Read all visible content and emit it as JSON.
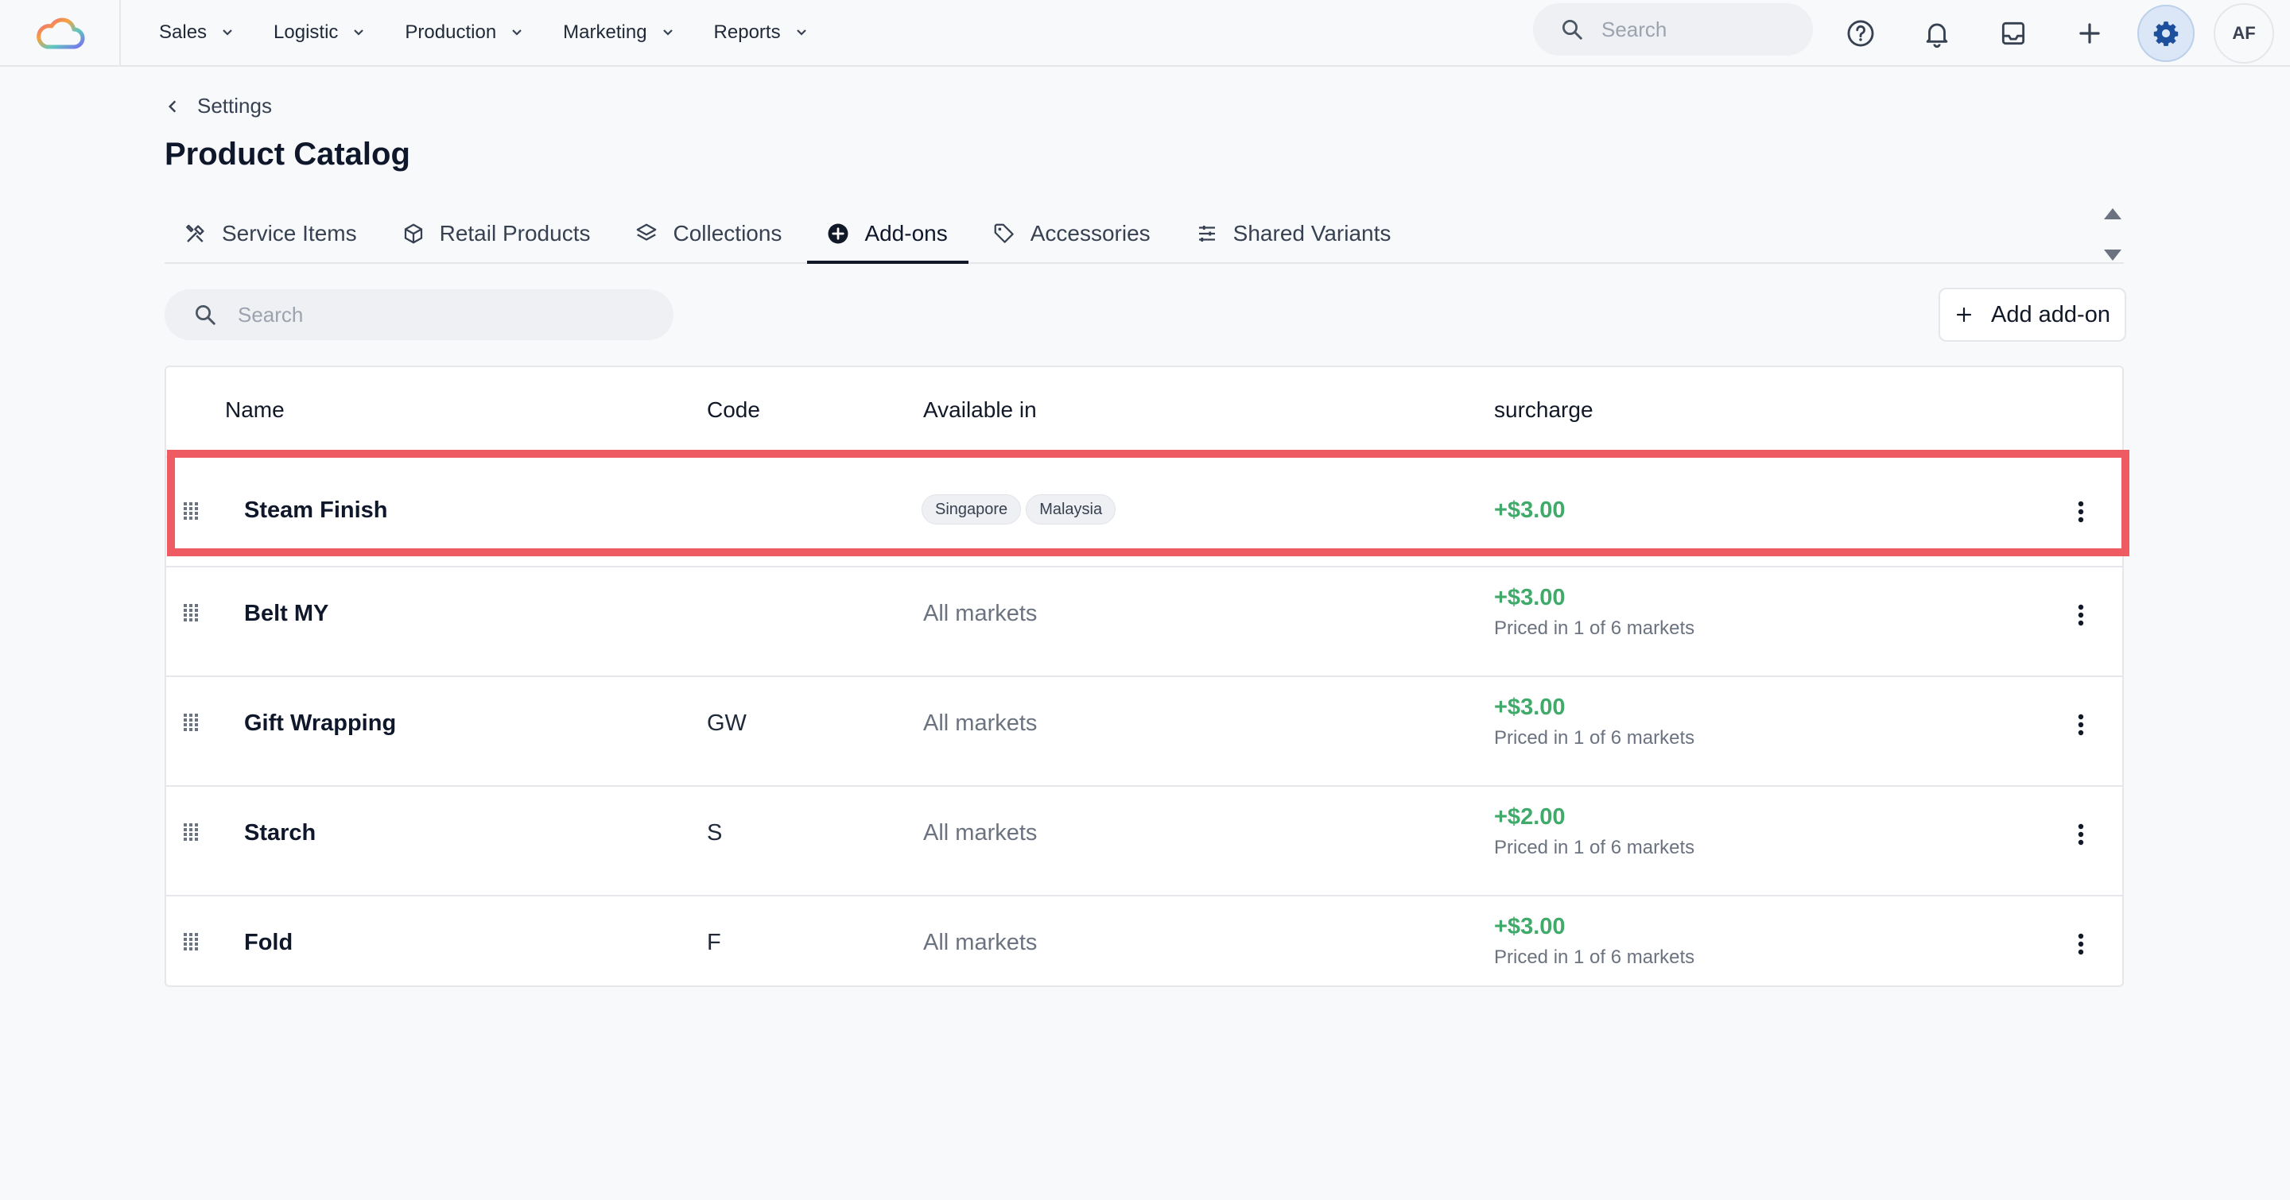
{
  "topbar": {
    "nav": [
      {
        "label": "Sales"
      },
      {
        "label": "Logistic"
      },
      {
        "label": "Production"
      },
      {
        "label": "Marketing"
      },
      {
        "label": "Reports"
      }
    ],
    "search_placeholder": "Search",
    "avatar_initials": "AF"
  },
  "page": {
    "breadcrumb": "Settings",
    "title": "Product Catalog"
  },
  "tabs": [
    {
      "label": "Service Items",
      "icon": "tools-icon"
    },
    {
      "label": "Retail Products",
      "icon": "box-icon"
    },
    {
      "label": "Collections",
      "icon": "layers-icon"
    },
    {
      "label": "Add-ons",
      "icon": "plus-circle-icon",
      "active": true
    },
    {
      "label": "Accessories",
      "icon": "tag-icon"
    },
    {
      "label": "Shared Variants",
      "icon": "sliders-icon"
    }
  ],
  "toolbar": {
    "search_placeholder": "Search",
    "add_label": "Add add-on"
  },
  "table": {
    "headers": {
      "name": "Name",
      "code": "Code",
      "available": "Available in",
      "surcharge": "surcharge"
    },
    "rows": [
      {
        "name": "Steam Finish",
        "code": "",
        "markets": [
          "Singapore",
          "Malaysia"
        ],
        "price": "+$3.00",
        "note": ""
      },
      {
        "name": "Belt MY",
        "code": "",
        "available": "All markets",
        "price": "+$3.00",
        "note": "Priced in 1 of 6 markets"
      },
      {
        "name": "Gift Wrapping",
        "code": "GW",
        "available": "All markets",
        "price": "+$3.00",
        "note": "Priced in 1 of 6 markets"
      },
      {
        "name": "Starch",
        "code": "S",
        "available": "All markets",
        "price": "+$2.00",
        "note": "Priced in 1 of 6 markets"
      },
      {
        "name": "Fold",
        "code": "F",
        "available": "All markets",
        "price": "+$3.00",
        "note": "Priced in 1 of 6 markets"
      }
    ]
  },
  "colors": {
    "accent_green": "#3faa6a",
    "highlight": "#ef5b63",
    "settings_active": "#1e4f9c"
  }
}
